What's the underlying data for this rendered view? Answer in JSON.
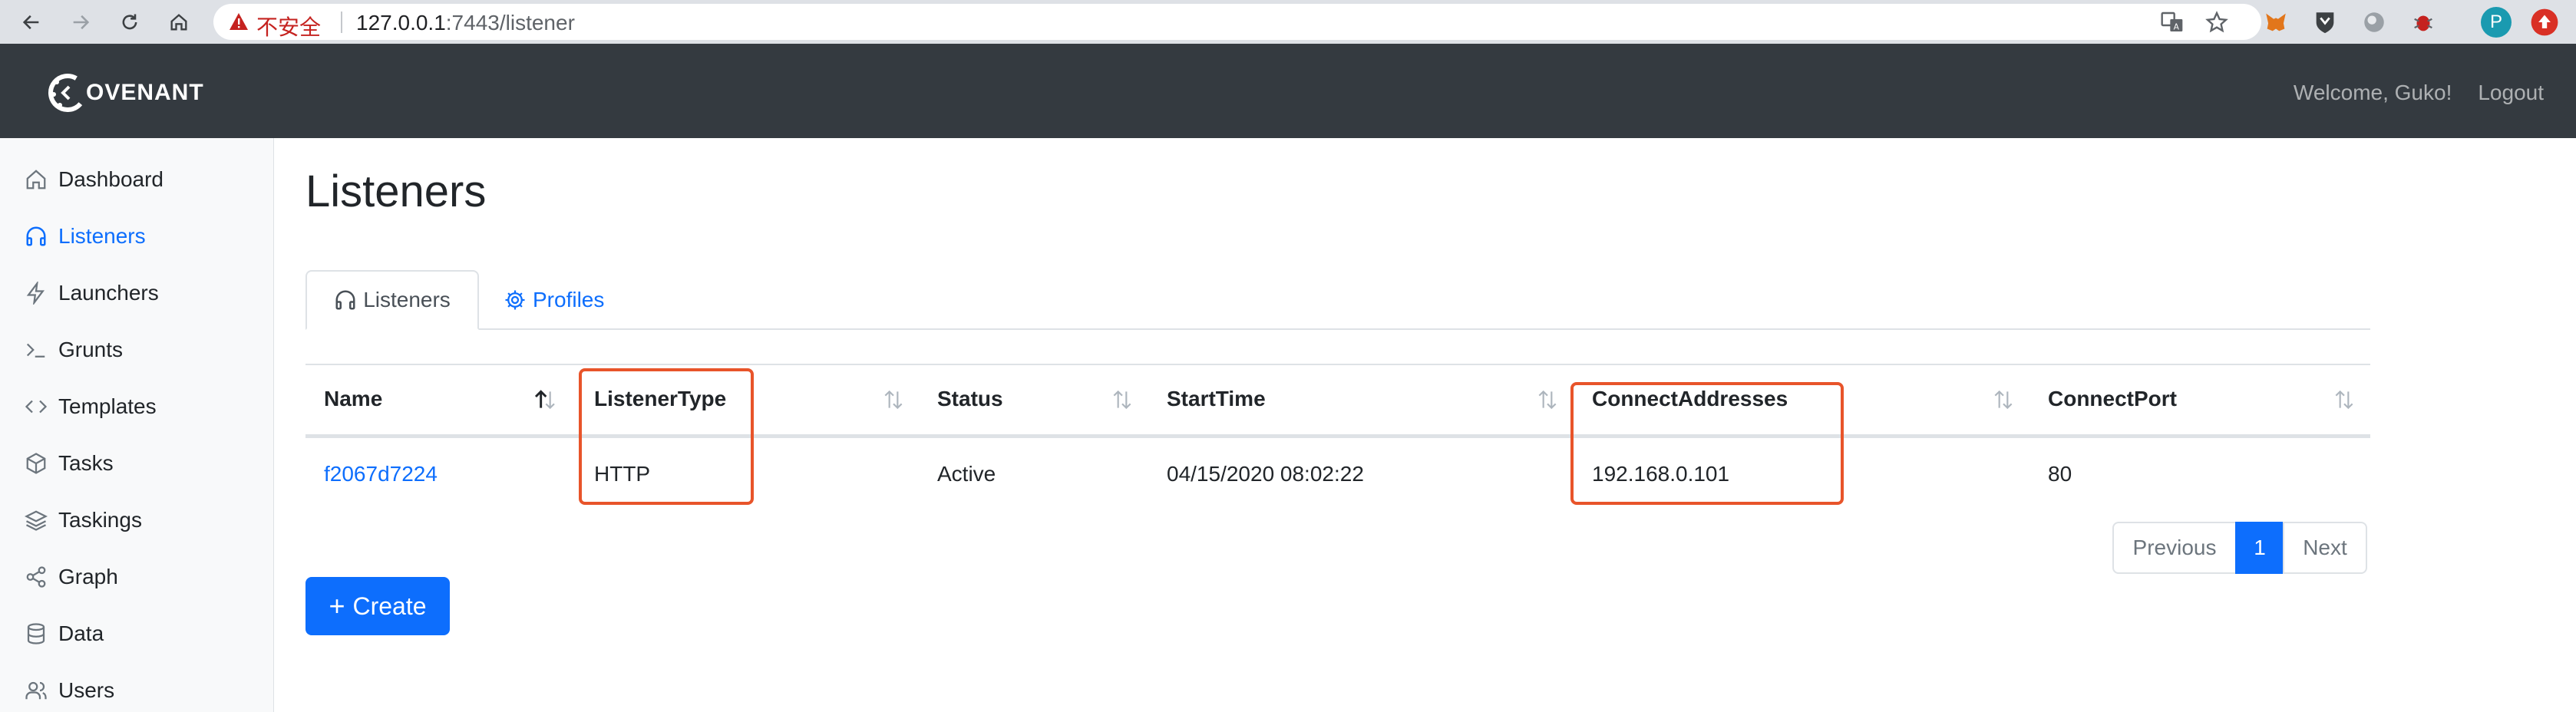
{
  "browser": {
    "insecure_label": "不安全",
    "url_host": "127.0.0.1",
    "url_rest": ":7443/listener",
    "profile_initial": "P"
  },
  "navbar": {
    "brand": "OVENANT",
    "welcome": "Welcome, Guko!",
    "logout": "Logout"
  },
  "sidebar": {
    "items": [
      {
        "label": "Dashboard",
        "icon": "home-icon"
      },
      {
        "label": "Listeners",
        "icon": "headphones-icon"
      },
      {
        "label": "Launchers",
        "icon": "lightning-icon"
      },
      {
        "label": "Grunts",
        "icon": "terminal-icon"
      },
      {
        "label": "Templates",
        "icon": "code-icon"
      },
      {
        "label": "Tasks",
        "icon": "box-icon"
      },
      {
        "label": "Taskings",
        "icon": "layers-icon"
      },
      {
        "label": "Graph",
        "icon": "share-icon"
      },
      {
        "label": "Data",
        "icon": "database-icon"
      },
      {
        "label": "Users",
        "icon": "users-icon"
      }
    ]
  },
  "main": {
    "title": "Listeners",
    "tabs": [
      {
        "label": "Listeners",
        "icon": "headphones-icon",
        "active": true
      },
      {
        "label": "Profiles",
        "icon": "gear-icon",
        "active": false
      }
    ],
    "table": {
      "columns": [
        "Name",
        "ListenerType",
        "Status",
        "StartTime",
        "ConnectAddresses",
        "ConnectPort"
      ],
      "rows": [
        [
          "f2067d7224",
          "HTTP",
          "Active",
          "04/15/2020 08:02:22",
          "192.168.0.101",
          "80"
        ]
      ]
    },
    "pagination": {
      "previous": "Previous",
      "current": "1",
      "next": "Next"
    },
    "create_button": "Create",
    "create_plus": "+"
  },
  "colors": {
    "accent": "#0d6efd",
    "navbar": "#343a40",
    "highlight": "#e8542a"
  }
}
